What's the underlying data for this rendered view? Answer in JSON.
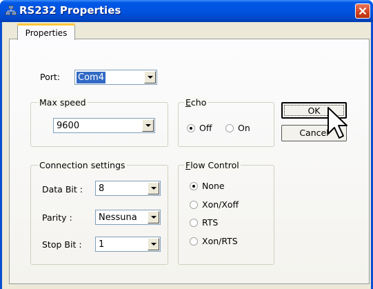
{
  "window": {
    "title": "RS232 Properties",
    "close_icon": "close-icon"
  },
  "tabs": [
    {
      "label": "Properties",
      "active": true
    }
  ],
  "port": {
    "label": "Port:",
    "value": "Com4"
  },
  "max_speed": {
    "title": "Max speed",
    "value": "9600"
  },
  "echo": {
    "title_first": "E",
    "title_rest": "cho",
    "options": [
      {
        "label": "Off",
        "checked": true
      },
      {
        "label": "On",
        "checked": false
      }
    ]
  },
  "connection": {
    "title": "Connection settings",
    "data_bit_label": "Data Bit :",
    "data_bit_value": "8",
    "parity_label": "Parity :",
    "parity_value": "Nessuna",
    "stop_bit_label": "Stop Bit :",
    "stop_bit_value": "1"
  },
  "flow_control": {
    "title_first": "F",
    "title_rest": "low Control",
    "options": [
      {
        "label": "None",
        "checked": true
      },
      {
        "label": "Xon/Xoff",
        "checked": false
      },
      {
        "label": "RTS",
        "checked": false
      },
      {
        "label": "Xon/RTS",
        "checked": false
      }
    ]
  },
  "buttons": {
    "ok": "OK",
    "cancel": "Cancel"
  },
  "colors": {
    "titlebar": "#0054e3",
    "dialog_face": "#ece9d8",
    "selection": "#316ac5",
    "close": "#d1411e"
  }
}
